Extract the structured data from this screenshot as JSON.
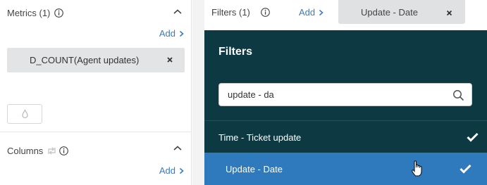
{
  "metrics": {
    "title": "Metrics (1)",
    "add_label": "Add",
    "item_label": "D_COUNT(Agent updates)"
  },
  "columns": {
    "title": "Columns",
    "add_label": "Add"
  },
  "filters": {
    "title": "Filters (1)",
    "add_label": "Add",
    "active_chip": "Update - Date"
  },
  "dropdown": {
    "title": "Filters",
    "search_value": "update - da",
    "items": [
      {
        "label": "Time - Ticket update",
        "selected": true
      },
      {
        "label": "Update - Date",
        "selected": true,
        "highlighted": true
      }
    ]
  },
  "colors": {
    "dropdown_bg": "#0d3a42",
    "highlight": "#2f79bd",
    "link": "#3a7bbf",
    "chip_bg": "#e2e4e6"
  },
  "icons": [
    "info-icon",
    "chevron-up-icon",
    "chevron-right-icon",
    "close-icon",
    "drop-icon",
    "swap-icon",
    "search-icon",
    "check-icon",
    "hand-cursor-icon"
  ]
}
